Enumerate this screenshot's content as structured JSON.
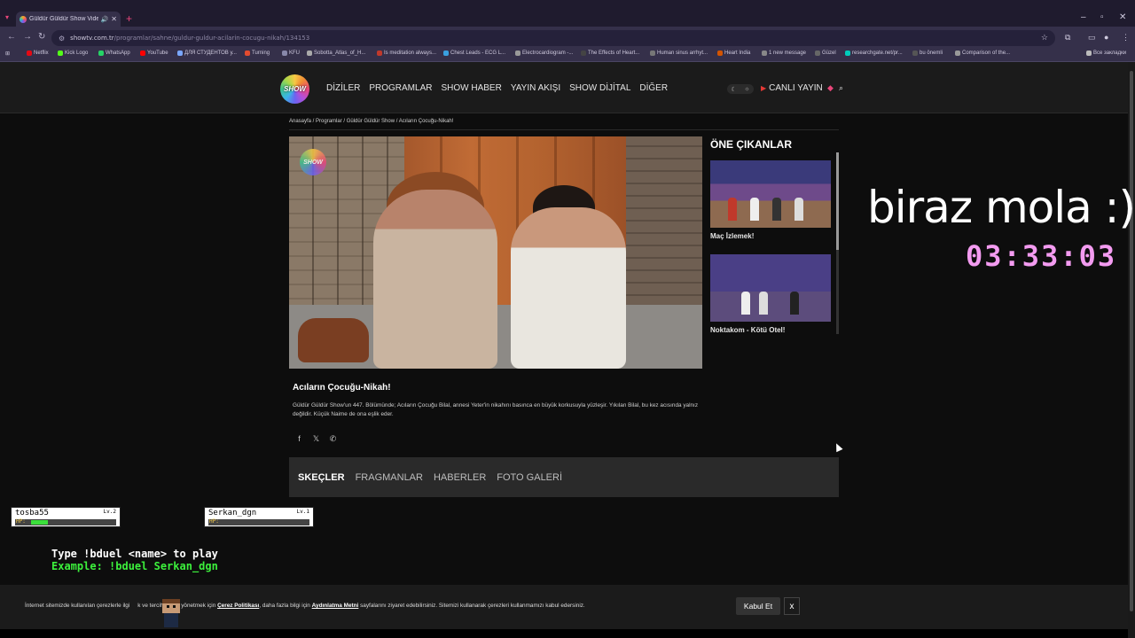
{
  "browser": {
    "tab_title": "Güldür Güldür Show Video",
    "url_host": "showtv.com.tr",
    "url_path": "/programlar/sahne/guldur-guldur-acilarin-cocugu-nikah/134153",
    "bookmarks": [
      "Netflix",
      "Kick Logo",
      "WhatsApp",
      "YouTube",
      "ДЛЯ СТУДЕНТОВ у...",
      "Turning",
      "KFU",
      "Sobotta_Atlas_of_H...",
      "Is meditation always...",
      "Chest Leads - ECG L...",
      "Electrocardiogram -...",
      "The Effects of Heart...",
      "Human sinus arrhyt...",
      "Heart India",
      "1 new message",
      "Güzel",
      "researchgate.net/pr...",
      "bu önemli",
      "Comparison of the..."
    ],
    "bookmarks_other": "Все закладки"
  },
  "site": {
    "logo_text": "SHOW",
    "nav": [
      "DİZİLER",
      "PROGRAMLAR",
      "SHOW HABER",
      "YAYIN AKIŞI",
      "SHOW DİJİTAL",
      "DİĞER"
    ],
    "live_label": "CANLI YAYIN"
  },
  "breadcrumb": "Anasayfa / Programlar / Güldür Güldür Show / Acıların Çocuğu-Nikah!",
  "sidebar": {
    "title": "ÖNE ÇIKANLAR",
    "items": [
      {
        "caption": "Maç İzlemek!"
      },
      {
        "caption": "Noktakom - Kötü Otel!"
      }
    ]
  },
  "episode": {
    "title": "Acıların Çocuğu-Nikah!",
    "description": "Güldür Güldür Show'un 447. Bölümünde; Acıların Çocuğu Bilal, annesi Yeter'in nikahını basınca en büyük korkusuyla yüzleşir. Yıkılan Bilal, bu kez acısında yalnız değildir. Küçük Naime de ona eşlik eder."
  },
  "tabs": [
    "SKEÇLER",
    "FRAGMANLAR",
    "HABERLER",
    "FOTO GALERİ"
  ],
  "overlay": {
    "break_text": "biraz mola :)",
    "timer": "03:33:03",
    "players": [
      {
        "name": "tosba55",
        "level": "Lv.2",
        "hp_label": "HP:",
        "hp": 0.2
      },
      {
        "name": "Serkan_dgn",
        "level": "Lv.1",
        "hp_label": "HP:",
        "hp": 0.0
      }
    ],
    "duel_line1": "Type !bduel <name> to play",
    "duel_line2": "Example: !bduel Serkan_dgn"
  },
  "cookie": {
    "text_a": "İnternet sitemizde kullanılan çerezlerle ilgi",
    "text_b": "k ve tercihlerinizi yönetmek için",
    "link1": "Çerez Politikası",
    "text_c": ", daha fazla bilgi için",
    "link2": "Aydınlatma Metni",
    "text_d": "sayfalarını ziyaret edebilirsiniz. Sitemizi kullanarak çerezleri kullanmamızı kabul edersiniz.",
    "accept_label": "Kabul Et",
    "close_label": "x"
  }
}
